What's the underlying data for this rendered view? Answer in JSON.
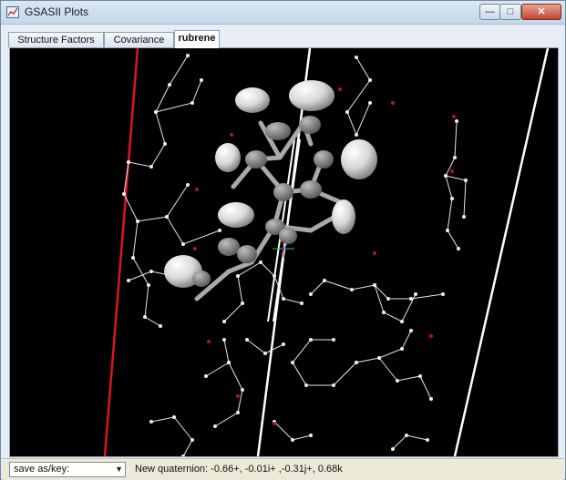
{
  "window": {
    "title": "GSASII Plots"
  },
  "tabs": [
    {
      "label": "Structure Factors",
      "active": false
    },
    {
      "label": "Covariance",
      "active": false
    },
    {
      "label": "rubrene",
      "active": true
    }
  ],
  "toolbar": {
    "save_select_value": "save as/key:"
  },
  "status": {
    "message": "New quaternion: -0.66+, -0.01i+ ,-0.31j+, 0.68k"
  },
  "colors": {
    "plot_background": "#000000",
    "unit_cell_axis": "#e0141e",
    "cell_edge": "#ffffff",
    "atom": "#e6e6e6",
    "minor_atom": "#b01818"
  }
}
